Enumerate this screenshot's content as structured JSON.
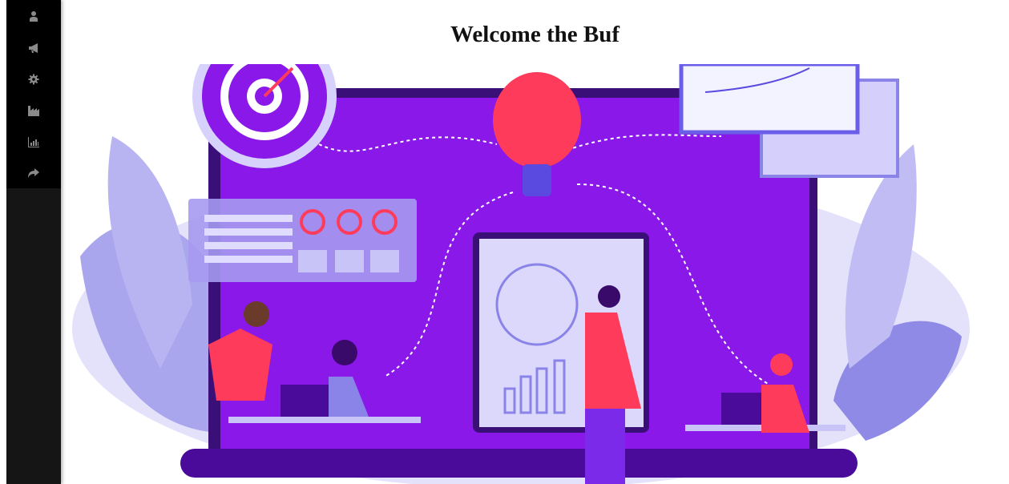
{
  "sidebar": {
    "items": [
      {
        "icon": "user-icon"
      },
      {
        "icon": "bullhorn-icon"
      },
      {
        "icon": "gear-icon"
      },
      {
        "icon": "industry-icon"
      },
      {
        "icon": "bar-chart-icon"
      },
      {
        "icon": "share-icon"
      }
    ]
  },
  "header": {
    "title": "Welcome the Buf"
  },
  "colors": {
    "primary": "#8a18e8",
    "accent": "#ff2f5a",
    "light": "#c9c6f5"
  }
}
